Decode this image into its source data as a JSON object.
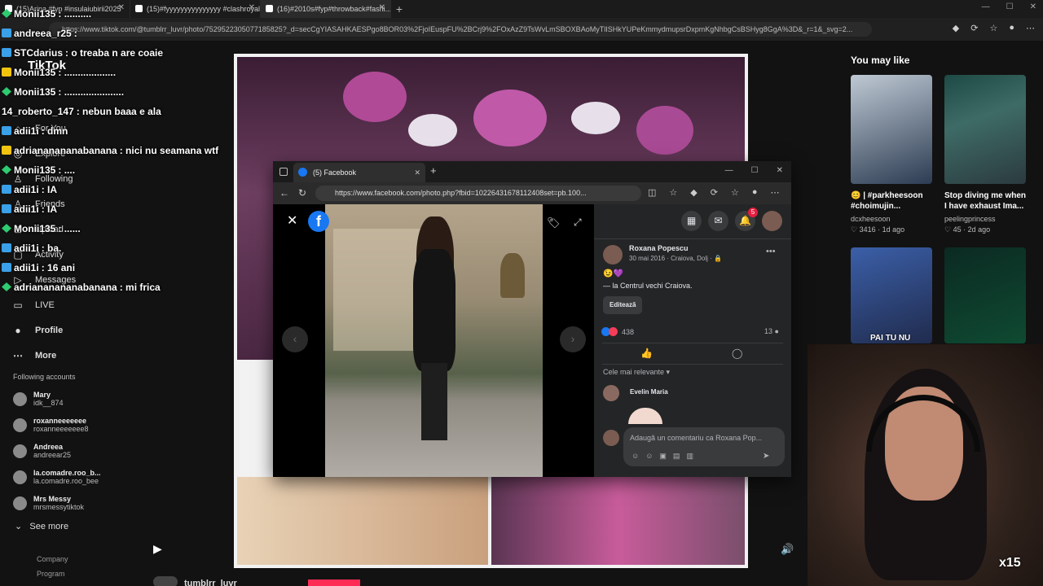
{
  "browser": {
    "tabs": [
      {
        "label": "(15)Arina #fyp #insulaiubirii2025"
      },
      {
        "label": "(15)#fyyyyyyyyyyyyyyy #clashroyale"
      },
      {
        "label": "(16)#2010s#fyp#throwback#fashi..."
      }
    ],
    "url": "https://www.tiktok.com/@tumblrr_luvr/photo/7529522305077185825?_d=secCgYIASAHKAESPgo8BOR03%2FjoIEuspFU%2BCrj9%2FOxAzZ9TsWvLmSBOXBAoMyTlISHkYUPeKmmydmupsrDxpmKgNhbgCsBSHyg8GgA%3D&_r=1&_svg=2..."
  },
  "sidebar": {
    "logo": "TikTok",
    "nav": [
      {
        "label": "For You",
        "icon": "home-icon"
      },
      {
        "label": "Explore",
        "icon": "compass-icon"
      },
      {
        "label": "Following",
        "icon": "following-icon"
      },
      {
        "label": "Friends",
        "icon": "friends-icon"
      },
      {
        "label": "Upload",
        "icon": "plus-icon"
      },
      {
        "label": "Activity",
        "icon": "activity-icon"
      },
      {
        "label": "Messages",
        "icon": "message-icon"
      },
      {
        "label": "LIVE",
        "icon": "live-icon"
      },
      {
        "label": "Profile",
        "icon": "profile-icon"
      },
      {
        "label": "More",
        "icon": "more-icon"
      }
    ],
    "following_head": "Following accounts",
    "accounts": [
      {
        "name": "Mary",
        "handle": "idk__874"
      },
      {
        "name": "roxanneeeeeee",
        "handle": "roxanneeeeeee8"
      },
      {
        "name": "Andreea",
        "handle": "andreear25"
      },
      {
        "name": "la.comadre.roo_b...",
        "handle": "la.comadre.roo_bee"
      },
      {
        "name": "Mrs Messy",
        "handle": "mrsmessytiktok"
      }
    ],
    "see_more": "See more",
    "footer": [
      "Company",
      "Program"
    ]
  },
  "chat": [
    {
      "user": "Monii135",
      "msg": ": ..........",
      "badge": "g"
    },
    {
      "user": "andreea_r25",
      "msg": ":",
      "badge": "b"
    },
    {
      "user": "STCdarius",
      "msg": ": o treaba n are coaie",
      "badge": "b"
    },
    {
      "user": "Monii135",
      "msg": ": ...................",
      "badge": "y"
    },
    {
      "user": "Monii135",
      "msg": ": ......................",
      "badge": "g"
    },
    {
      "user": "14_roberto_147",
      "msg": ": nebun baaa e ala",
      "badge": ""
    },
    {
      "user": "adii1i",
      "msg": ": dmn",
      "badge": "b"
    },
    {
      "user": "adriananananabanana",
      "msg": ": nici nu seamana wtf",
      "badge": "y"
    },
    {
      "user": "Monii135",
      "msg": ": ....",
      "badge": "g"
    },
    {
      "user": "adii1i",
      "msg": ": IA",
      "badge": "b"
    },
    {
      "user": "adii1i",
      "msg": ": IA",
      "badge": "b"
    },
    {
      "user": "Monii135",
      "msg": ": ......",
      "badge": "g"
    },
    {
      "user": "adii1i",
      "msg": ": ba.",
      "badge": "b"
    },
    {
      "user": "adii1i",
      "msg": ": 16 ani",
      "badge": "b"
    },
    {
      "user": "adriananananabanana",
      "msg": ": mi frica",
      "badge": "g"
    }
  ],
  "you_may_like": {
    "title": "You may like",
    "cards": [
      {
        "title": "😊 | #parkheesoon #choimujin...",
        "author": "dcxheesoon",
        "likes": "3416",
        "age": "1d ago"
      },
      {
        "title": "Stop diving me when I have exhaust Ima...",
        "author": "peelingprincess",
        "likes": "45",
        "age": "2d ago"
      }
    ],
    "overlay_text": "PAI TU NU"
  },
  "post_bottom": {
    "username": "tumblrr_luvr"
  },
  "webcam": {
    "multiplier": "x15"
  },
  "facebook": {
    "tab_title": "(5) Facebook",
    "url": "https://www.facebook.com/photo.php?fbid=10226431678112408set=pb.100...",
    "logo_letter": "f",
    "notif_count": "5",
    "poster": "Roxana Popescu",
    "post_meta": "30 mai 2016 · Craiova, Dolj · 🔒",
    "emoji": "😉💜",
    "location": "— la Centrul vechi Craiova.",
    "edit_label": "Editează",
    "reactions": "438",
    "comments": "13",
    "sort_label": "Cele mai relevante ▾",
    "commenter": "Evelin Maria",
    "comment_placeholder": "Adaugă un comentariu ca Roxana Pop..."
  },
  "colors": {
    "tiktok_pink": "#fe2c55",
    "fb_blue": "#1877f2"
  }
}
